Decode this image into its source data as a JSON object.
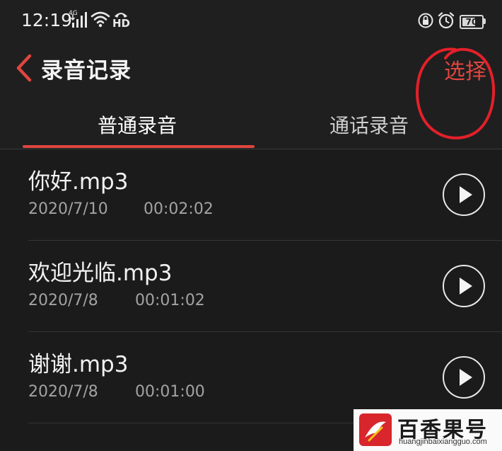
{
  "status_bar": {
    "time": "12:19",
    "network": "4G",
    "hd": "HD",
    "battery": "70",
    "battery_fraction": 0.7,
    "icons": [
      "signal-icon",
      "wifi-icon",
      "call-hd-icon",
      "rotation-lock-icon",
      "alarm-icon",
      "battery-icon"
    ]
  },
  "header": {
    "title": "录音记录",
    "select_label": "选择",
    "back_icon": "chevron-left-icon"
  },
  "tabs": [
    {
      "label": "普通录音",
      "active": true
    },
    {
      "label": "通话录音",
      "active": false
    }
  ],
  "recordings": [
    {
      "name": "你好.mp3",
      "date": "2020/7/10",
      "duration": "00:02:02"
    },
    {
      "name": "欢迎光临.mp3",
      "date": "2020/7/8",
      "duration": "00:01:02"
    },
    {
      "name": "谢谢.mp3",
      "date": "2020/7/8",
      "duration": "00:01:00"
    }
  ],
  "watermark": {
    "name": "百香果号",
    "url": "huangjinbaixiangguo.com"
  },
  "colors": {
    "accent": "#e0453f",
    "background": "#1f1f1f",
    "annotation": "#e3202a"
  }
}
